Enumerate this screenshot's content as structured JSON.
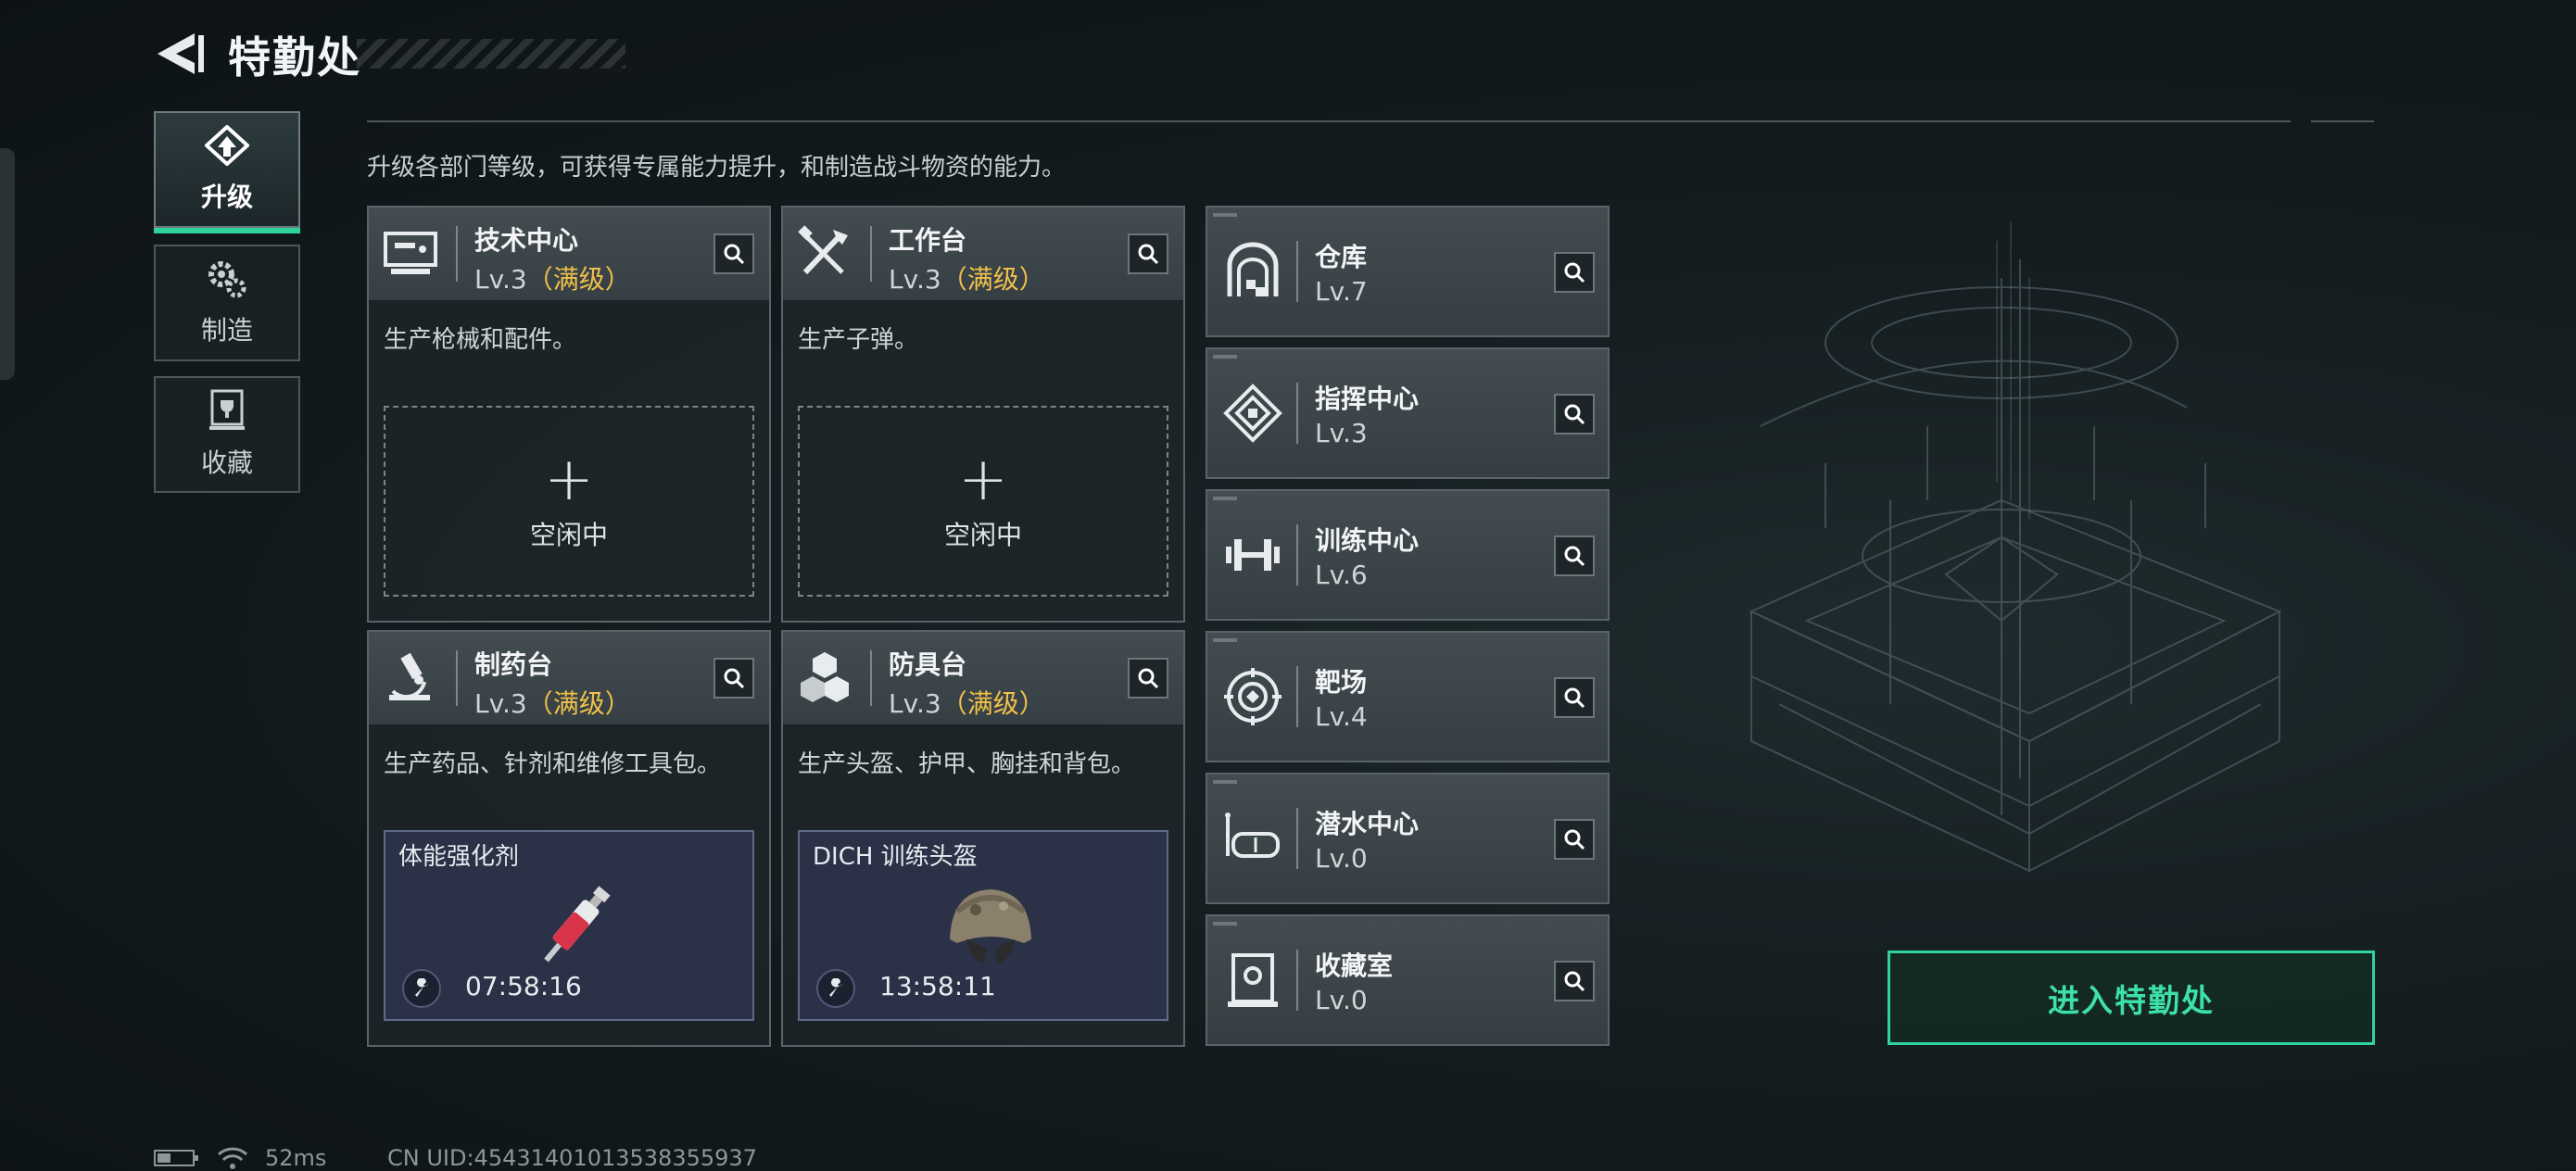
{
  "header": {
    "title": "特勤处"
  },
  "nav": [
    {
      "label": "升级",
      "icon": "upgrade-icon",
      "active": true
    },
    {
      "label": "制造",
      "icon": "gears-icon",
      "active": false
    },
    {
      "label": "收藏",
      "icon": "trophy-icon",
      "active": false
    }
  ],
  "description": "升级各部门等级，可获得专属能力提升，和制造战斗物资的能力。",
  "workbenches": [
    {
      "name": "技术中心",
      "level": "Lv.3",
      "max_tag": "（满级）",
      "icon": "computer-icon",
      "desc": "生产枪械和配件。",
      "slot": {
        "status": "idle",
        "plus": "+",
        "label": "空闲中"
      }
    },
    {
      "name": "工作台",
      "level": "Lv.3",
      "max_tag": "（满级）",
      "icon": "tools-icon",
      "desc": "生产子弹。",
      "slot": {
        "status": "idle",
        "plus": "+",
        "label": "空闲中"
      }
    },
    {
      "name": "制药台",
      "level": "Lv.3",
      "max_tag": "（满级）",
      "icon": "microscope-icon",
      "desc": "生产药品、针剂和维修工具包。",
      "slot": {
        "status": "producing",
        "item": "体能强化剂",
        "item_icon": "syringe-icon",
        "timer": "07:58:16"
      }
    },
    {
      "name": "防具台",
      "level": "Lv.3",
      "max_tag": "（满级）",
      "icon": "cubes-icon",
      "desc": "生产头盔、护甲、胸挂和背包。",
      "slot": {
        "status": "producing",
        "item": "DICH 训练头盔",
        "item_icon": "helmet-icon",
        "timer": "13:58:11"
      }
    }
  ],
  "facilities": [
    {
      "name": "仓库",
      "level": "Lv.7",
      "icon": "warehouse-icon"
    },
    {
      "name": "指挥中心",
      "level": "Lv.3",
      "icon": "command-chip-icon"
    },
    {
      "name": "训练中心",
      "level": "Lv.6",
      "icon": "dumbbell-icon"
    },
    {
      "name": "靶场",
      "level": "Lv.4",
      "icon": "target-icon"
    },
    {
      "name": "潜水中心",
      "level": "Lv.0",
      "icon": "diving-mask-icon"
    },
    {
      "name": "收藏室",
      "level": "Lv.0",
      "icon": "display-case-icon"
    }
  ],
  "enter_button": "进入特勤处",
  "status": {
    "ping": "52ms",
    "uid": "CN UID:45431401013538355937"
  },
  "colors": {
    "accent_green": "#31d39c",
    "max_level_gold": "#f0c14b",
    "production_slot": "#2b3147"
  }
}
